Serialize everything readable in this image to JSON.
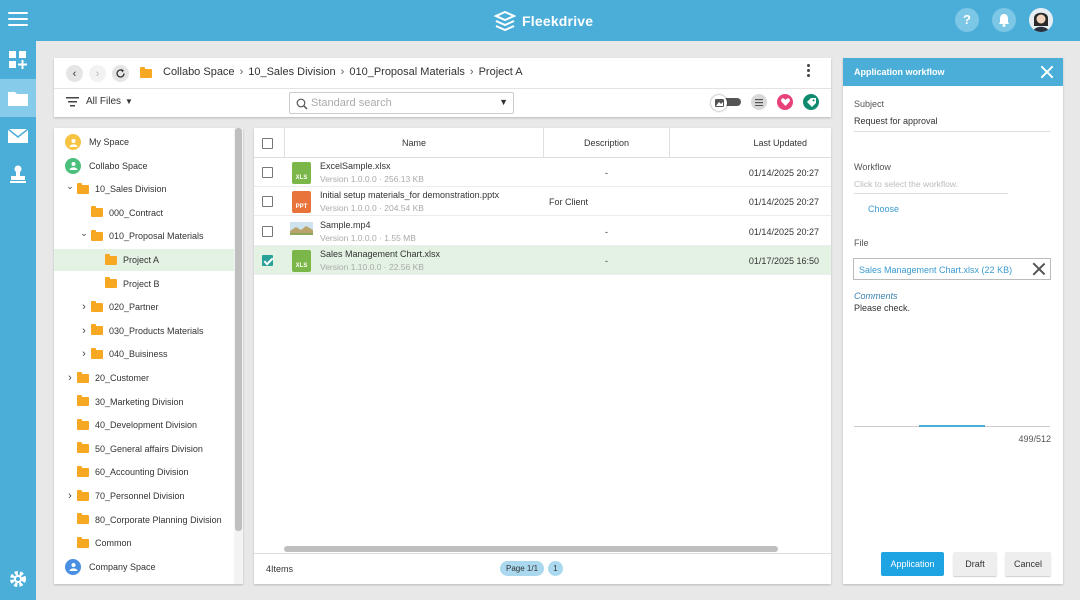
{
  "brand": {
    "name": "Fleekdrive"
  },
  "topbar": {
    "help_glyph": "?",
    "icons": [
      "help-icon",
      "bell-icon",
      "user-avatar"
    ]
  },
  "rail": {
    "icons": [
      "dashboard-add-icon",
      "folder-icon",
      "mail-icon",
      "approval-stamp-icon",
      "gear-icon"
    ],
    "active": "folder-icon"
  },
  "breadcrumb": [
    "Collabo Space",
    "10_Sales Division",
    "010_Proposal Materials",
    "Project A"
  ],
  "filter": {
    "label": "All Files"
  },
  "search": {
    "placeholder": "Standard search"
  },
  "tree": {
    "items": [
      {
        "label": "My Space",
        "level": 0,
        "type": "space",
        "color": "#f6c343"
      },
      {
        "label": "Collabo Space",
        "level": 0,
        "type": "space",
        "color": "#4cbf7a"
      },
      {
        "label": "10_Sales Division",
        "level": 1,
        "caret": "down"
      },
      {
        "label": "000_Contract",
        "level": 2
      },
      {
        "label": "010_Proposal Materials",
        "level": 2,
        "caret": "down"
      },
      {
        "label": "Project A",
        "level": 3,
        "selected": true
      },
      {
        "label": "Project B",
        "level": 3
      },
      {
        "label": "020_Partner",
        "level": 2,
        "caret": "right"
      },
      {
        "label": "030_Products Materials",
        "level": 2,
        "caret": "right"
      },
      {
        "label": "040_Buisiness",
        "level": 2,
        "caret": "right"
      },
      {
        "label": "20_Customer",
        "level": 1,
        "caret": "right"
      },
      {
        "label": "30_Marketing Division",
        "level": 1
      },
      {
        "label": "40_Development Division",
        "level": 1
      },
      {
        "label": "50_General affairs Division",
        "level": 1
      },
      {
        "label": "60_Accounting Division",
        "level": 1
      },
      {
        "label": "70_Personnel Division",
        "level": 1,
        "caret": "right"
      },
      {
        "label": "80_Corporate Planning Division",
        "level": 1
      },
      {
        "label": "Common",
        "level": 1
      },
      {
        "label": "Company Space",
        "level": 0,
        "type": "space",
        "color": "#4a90e2"
      }
    ]
  },
  "table": {
    "columns": {
      "name": "Name",
      "description": "Description",
      "updated": "Last Updated"
    },
    "rows": [
      {
        "name": "ExcelSample.xlsx",
        "meta": "Version 1.0.0.0 · 256.13 KB",
        "description": "-",
        "updated": "01/14/2025 20:27",
        "icon": "XLS",
        "icon_color": "#7ab648",
        "checked": false
      },
      {
        "name": "Initial setup materials_for demonstration.pptx",
        "meta": "Version 1.0.0.0 · 204.54 KB",
        "description": "For Client",
        "updated": "01/14/2025 20:27",
        "icon": "PPT",
        "icon_color": "#e8743b",
        "checked": false
      },
      {
        "name": "Sample.mp4",
        "meta": "Version 1.0.0.0 · 1.55 MB",
        "description": "-",
        "updated": "01/14/2025 20:27",
        "icon": "video-thumbnail",
        "icon_color": "#d8c79a",
        "checked": false
      },
      {
        "name": "Sales Management Chart.xlsx",
        "meta": "Version 1.10.0.0 · 22.56 KB",
        "description": "-",
        "updated": "01/17/2025 16:50",
        "icon": "XLS",
        "icon_color": "#7ab648",
        "checked": true
      }
    ],
    "count": "4Items",
    "page": "Page 1/1",
    "page_number": "1"
  },
  "workflow": {
    "title": "Application workflow",
    "subject_label": "Subject",
    "subject_value": "Request for approval",
    "workflow_label": "Workflow",
    "workflow_placeholder": "Click to select the workflow.",
    "choose": "Choose",
    "file_label": "File",
    "file_value": "Sales Management Chart.xlsx (22 KB)",
    "comments_label": "Comments",
    "comments_value": "Please check.",
    "char_count": "499/512",
    "buttons": {
      "apply": "Application",
      "draft": "Draft",
      "cancel": "Cancel"
    },
    "accent": "#1fa4e3"
  }
}
